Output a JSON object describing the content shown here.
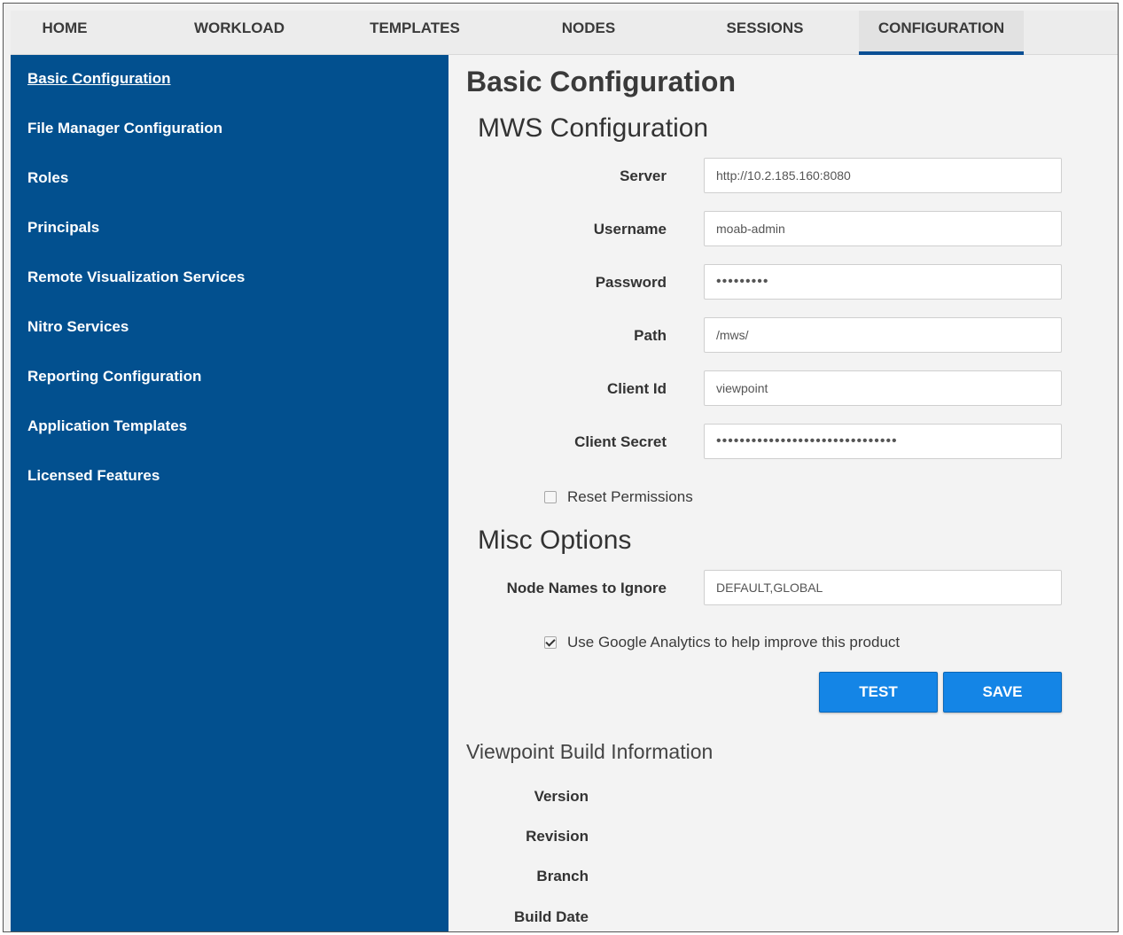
{
  "nav": {
    "tabs": [
      {
        "label": "HOME"
      },
      {
        "label": "WORKLOAD"
      },
      {
        "label": "TEMPLATES"
      },
      {
        "label": "NODES"
      },
      {
        "label": "SESSIONS"
      },
      {
        "label": "CONFIGURATION",
        "active": true
      }
    ]
  },
  "sidebar": {
    "items": [
      {
        "label": "Basic Configuration",
        "active": true
      },
      {
        "label": "File Manager Configuration"
      },
      {
        "label": "Roles"
      },
      {
        "label": "Principals"
      },
      {
        "label": "Remote Visualization Services"
      },
      {
        "label": "Nitro Services"
      },
      {
        "label": "Reporting Configuration"
      },
      {
        "label": "Application Templates"
      },
      {
        "label": "Licensed Features"
      }
    ]
  },
  "main": {
    "title": "Basic Configuration",
    "mws": {
      "heading": "MWS Configuration",
      "fields": [
        {
          "label": "Server",
          "value": "http://10.2.185.160:8080"
        },
        {
          "label": "Username",
          "value": "moab-admin"
        },
        {
          "label": "Password",
          "value": "•••••••••"
        },
        {
          "label": "Path",
          "value": "/mws/"
        },
        {
          "label": "Client Id",
          "value": "viewpoint"
        },
        {
          "label": "Client Secret",
          "value": "•••••••••••••••••••••••••••••••"
        }
      ],
      "reset_permissions": {
        "label": "Reset Permissions",
        "checked": false
      }
    },
    "misc": {
      "heading": "Misc Options",
      "node_names_label": "Node Names to Ignore",
      "node_names_value": "DEFAULT,GLOBAL",
      "analytics": {
        "label": "Use Google Analytics to help improve this product",
        "checked": true
      }
    },
    "buttons": {
      "test": "TEST",
      "save": "SAVE"
    },
    "build": {
      "heading": "Viewpoint Build Information",
      "labels": [
        "Version",
        "Revision",
        "Branch",
        "Build Date"
      ]
    }
  },
  "colors": {
    "sidebar_bg": "#02508f",
    "button_bg": "#1485e6",
    "active_tab_underline": "#0b4f94"
  }
}
